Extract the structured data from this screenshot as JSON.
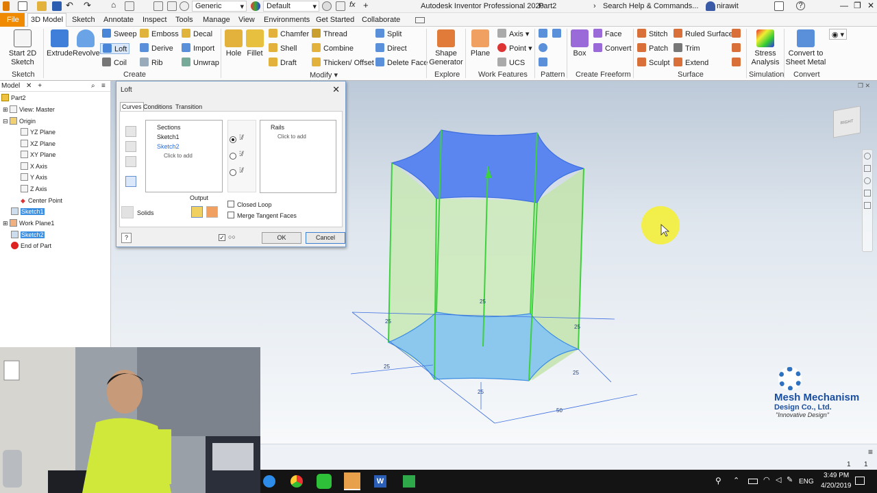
{
  "titlebar": {
    "material_combo": "Generic",
    "appearance_combo": "Default",
    "app_title": "Autodesk Inventor Professional 2020",
    "doc_name": "Part2",
    "search_placeholder": "Search Help & Commands...",
    "user": "nirawit",
    "help": "?"
  },
  "menu": {
    "file": "File",
    "tabs": [
      "3D Model",
      "Sketch",
      "Annotate",
      "Inspect",
      "Tools",
      "Manage",
      "View",
      "Environments",
      "Get Started",
      "Collaborate"
    ]
  },
  "ribbon": {
    "start_sketch": "Start 2D Sketch",
    "sketch_group": "Sketch",
    "create_group": "Create",
    "modify_group": "Modify",
    "explore_group": "Explore",
    "work_features_group": "Work Features",
    "pattern_group": "Pattern",
    "freeform_group": "Create Freeform",
    "surface_group": "Surface",
    "simulation_group": "Simulation",
    "convert_group": "Convert",
    "extrude": "Extrude",
    "revolve": "Revolve",
    "sweep": "Sweep",
    "loft": "Loft",
    "coil": "Coil",
    "emboss": "Emboss",
    "derive": "Derive",
    "rib": "Rib",
    "decal": "Decal",
    "import": "Import",
    "unwrap": "Unwrap",
    "hole": "Hole",
    "fillet": "Fillet",
    "chamfer": "Chamfer",
    "shell": "Shell",
    "draft": "Draft",
    "thread": "Thread",
    "combine": "Combine",
    "thicken": "Thicken/ Offset",
    "split": "Split",
    "direct": "Direct",
    "delete_face": "Delete Face",
    "shape_generator": "Shape Generator",
    "plane": "Plane",
    "axis": "Axis",
    "point": "Point",
    "ucs": "UCS",
    "box": "Box",
    "face": "Face",
    "convert": "Convert",
    "stitch": "Stitch",
    "patch": "Patch",
    "sculpt": "Sculpt",
    "ruled_surface": "Ruled Surface",
    "trim": "Trim",
    "extend": "Extend",
    "stress_analysis": "Stress Analysis",
    "convert_sheet_metal": "Convert to Sheet Metal"
  },
  "browser": {
    "header": "Model",
    "nodes": {
      "part": "Part2",
      "view": "View: Master",
      "origin": "Origin",
      "yz": "YZ Plane",
      "xz": "XZ Plane",
      "xy": "XY Plane",
      "xaxis": "X Axis",
      "yaxis": "Y Axis",
      "zaxis": "Z Axis",
      "center": "Center Point",
      "sketch1": "Sketch1",
      "workplane1": "Work Plane1",
      "sketch2": "Sketch2",
      "end": "End of Part"
    }
  },
  "loft": {
    "title": "Loft",
    "tabs": [
      "Curves",
      "Conditions",
      "Transition"
    ],
    "sections_header": "Sections",
    "sections": [
      "Sketch1",
      "Sketch2"
    ],
    "click_to_add": "Click to add",
    "rails_header": "Rails",
    "rails_click": "Click to add",
    "output_label": "Output",
    "solids_label": "Solids",
    "closed_loop": "Closed Loop",
    "merge_tangent": "Merge Tangent Faces",
    "ok": "OK",
    "cancel": "Cancel"
  },
  "viewport": {
    "viewcube_label": "RIGHT",
    "dims": [
      "25",
      "25",
      "25",
      "25",
      "25",
      "25",
      "50"
    ],
    "watermark_title": "Mesh Mechanism",
    "watermark_sub": "Design Co., Ltd.",
    "watermark_slogan": "\"Innovative Design\""
  },
  "statusbar": {
    "left_num": "1",
    "right_num": "1"
  },
  "taskbar": {
    "lang": "ENG",
    "time": "3:49 PM",
    "date": "4/20/2019"
  },
  "colors": {
    "accent": "#f08a00",
    "solid_top": "#5b86f0",
    "solid_side": "#c8e8b4",
    "solid_bottom": "#8cc7ee",
    "edge": "#3dd13d",
    "cursor": "#f4f03a"
  }
}
